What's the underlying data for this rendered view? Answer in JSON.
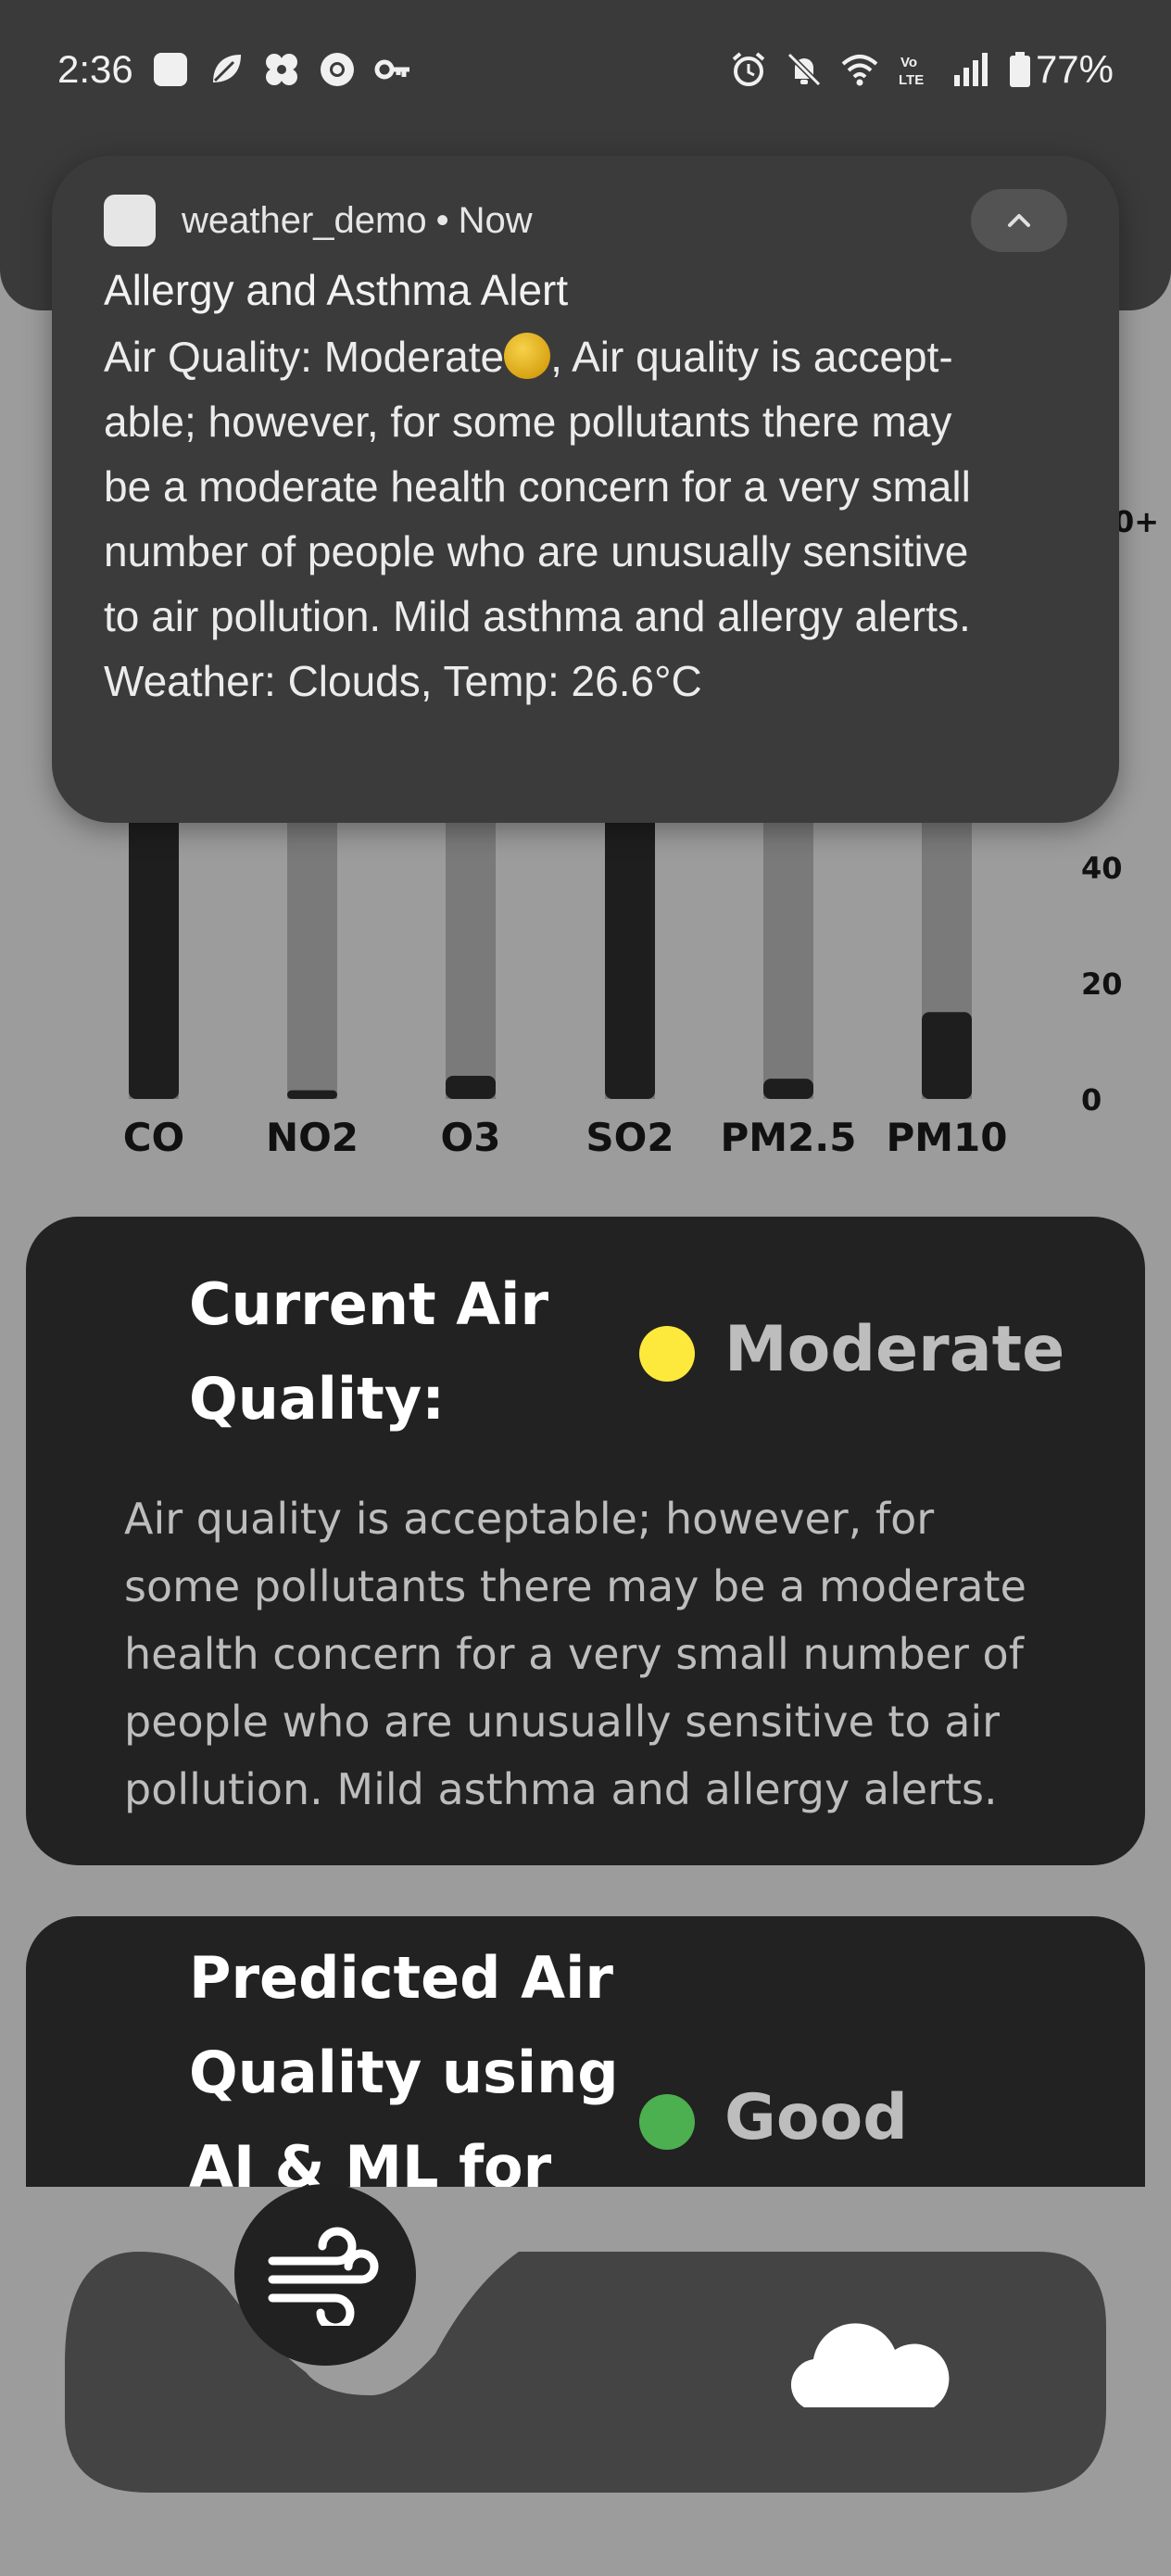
{
  "status_bar": {
    "time": "2:36",
    "battery": "77%",
    "left_icons": [
      "app-square-icon",
      "leaf-icon",
      "pinwheel-icon",
      "chrome-icon",
      "key-icon"
    ],
    "right_icons": [
      "alarm-icon",
      "bell-off-icon",
      "wifi-icon",
      "volte-icon",
      "signal-icon",
      "battery-icon"
    ]
  },
  "notification": {
    "app": "weather_demo",
    "dot": "•",
    "time": "Now",
    "title": "Allergy and Asthma Alert",
    "body_lines": [
      "Air Quality: Moderate",
      ", Air quality is accept-",
      "able; however, for some pollutants there may",
      "be a moderate health concern for a very small",
      "number of people who are unusually sensitive",
      "to air pollution. Mild asthma and allergy alerts.",
      "Weather: Clouds, Temp: 26.6°C"
    ]
  },
  "chart_data": {
    "type": "bar",
    "categories": [
      "CO",
      "NO2",
      "O3",
      "SO2",
      "PM2.5",
      "PM10"
    ],
    "values": [
      100,
      1.5,
      4,
      100,
      3.5,
      15
    ],
    "ylim": [
      0,
      100
    ],
    "y_ticks": [
      "0",
      "20",
      "40"
    ],
    "y_top_label": "0+",
    "colors": {
      "value": "#1e1e1e",
      "track": "#7a7a7a"
    }
  },
  "current_card": {
    "title_lines": [
      "Current Air",
      "Quality:"
    ],
    "status": "Moderate",
    "status_color": "#fde93b",
    "description_lines": [
      "Air quality is acceptable; however, for",
      "some pollutants there may be a moderate",
      "health concern for a very small number of",
      "people who are unusually sensitive to air",
      "pollution. Mild asthma and allergy alerts."
    ]
  },
  "predicted_card": {
    "title_lines": [
      "Predicted Air",
      "Quality using",
      "AI & ML for"
    ],
    "status": "Good",
    "status_color": "#4caf50"
  },
  "bottom_nav": {
    "items": [
      {
        "icon": "wind-icon",
        "active": true
      },
      {
        "icon": "cloud-icon",
        "active": false
      }
    ]
  }
}
